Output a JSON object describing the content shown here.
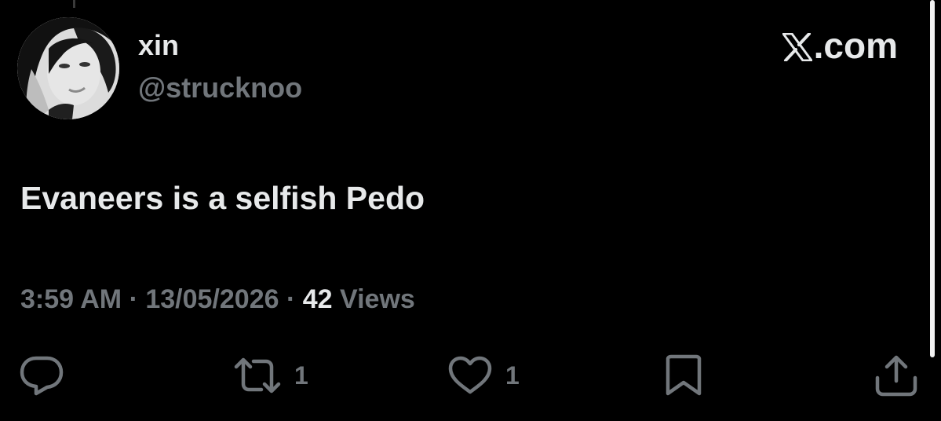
{
  "author": {
    "display_name": "xin",
    "handle": "@strucknoo"
  },
  "brand": {
    "label": ".com",
    "icon": "x-logo-icon"
  },
  "tweet": {
    "text": "Evaneers is a selfish Pedo"
  },
  "meta": {
    "time": "3:59 AM",
    "separator": "·",
    "date": "13/05/2026",
    "views_count": "42",
    "views_label": "Views"
  },
  "actions": {
    "reply": {
      "icon": "reply-icon"
    },
    "repost": {
      "icon": "repost-icon",
      "count": "1"
    },
    "like": {
      "icon": "heart-icon",
      "count": "1"
    },
    "bookmark": {
      "icon": "bookmark-icon"
    },
    "share": {
      "icon": "share-icon"
    }
  },
  "colors": {
    "background": "#000000",
    "primary_text": "#e7e9ea",
    "secondary_text": "#71767b"
  }
}
